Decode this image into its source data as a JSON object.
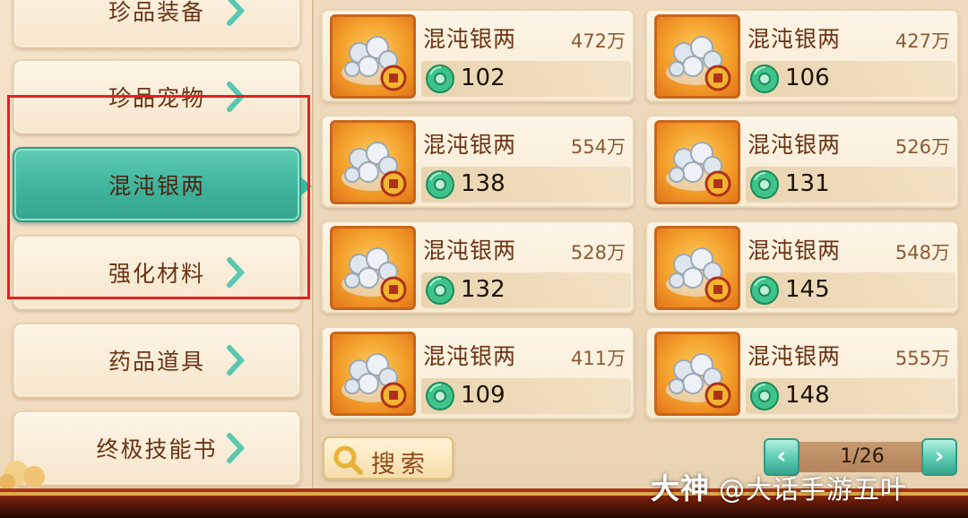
{
  "sidebar": {
    "items": [
      {
        "label": "珍品装备",
        "active": false
      },
      {
        "label": "珍品宠物",
        "active": false
      },
      {
        "label": "混沌银两",
        "active": true
      },
      {
        "label": "强化材料",
        "active": false
      },
      {
        "label": "药品道具",
        "active": false
      },
      {
        "label": "终极技能书",
        "active": false
      }
    ]
  },
  "listings": [
    {
      "name": "混沌银两",
      "amount": "472万",
      "price": "102"
    },
    {
      "name": "混沌银两",
      "amount": "427万",
      "price": "106"
    },
    {
      "name": "混沌银两",
      "amount": "554万",
      "price": "138"
    },
    {
      "name": "混沌银两",
      "amount": "526万",
      "price": "131"
    },
    {
      "name": "混沌银两",
      "amount": "528万",
      "price": "132"
    },
    {
      "name": "混沌银两",
      "amount": "548万",
      "price": "145"
    },
    {
      "name": "混沌银两",
      "amount": "411万",
      "price": "109"
    },
    {
      "name": "混沌银两",
      "amount": "555万",
      "price": "148"
    }
  ],
  "search": {
    "label": "搜索"
  },
  "pagination": {
    "text": "1/26",
    "prev": "‹",
    "next": "›"
  },
  "watermark": {
    "brand": "大神",
    "handle": "@大话手游五叶"
  },
  "colors": {
    "accent_teal": "#3fb39c",
    "highlight_red": "#e32121",
    "text_brown": "#6b3314"
  },
  "icons": {
    "currency": "jade-coin-icon",
    "item": "silver-ingots-icon",
    "search": "magnifier-icon",
    "chevron": "chevron-right-icon"
  }
}
